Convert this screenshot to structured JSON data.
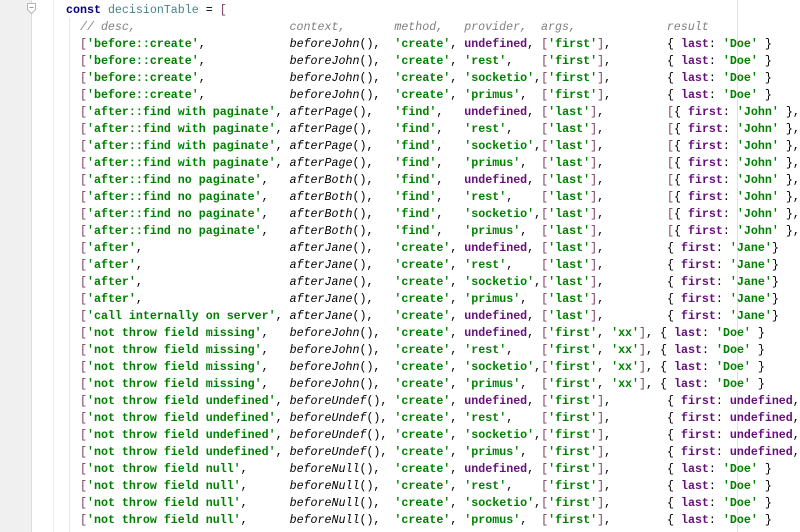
{
  "editor": {
    "lines": [
      "const decisionTable = [",
      "  // desc,                      context,       method,   provider,  args,             result",
      "  ['before::create',            beforeJohn(),  'create', undefined, ['first'],        { last: 'Doe' }",
      "  ['before::create',            beforeJohn(),  'create', 'rest',    ['first'],        { last: 'Doe' }",
      "  ['before::create',            beforeJohn(),  'create', 'socketio',['first'],        { last: 'Doe' }",
      "  ['before::create',            beforeJohn(),  'create', 'primus',  ['first'],        { last: 'Doe' }",
      "  ['after::find with paginate', afterPage(),   'find',   undefined, ['last'],         [{ first: 'John' },",
      "  ['after::find with paginate', afterPage(),   'find',   'rest',    ['last'],         [{ first: 'John' },",
      "  ['after::find with paginate', afterPage(),   'find',   'socketio',['last'],         [{ first: 'John' },",
      "  ['after::find with paginate', afterPage(),   'find',   'primus',  ['last'],         [{ first: 'John' },",
      "  ['after::find no paginate',   afterBoth(),   'find',   undefined, ['last'],         [{ first: 'John' },",
      "  ['after::find no paginate',   afterBoth(),   'find',   'rest',    ['last'],         [{ first: 'John' },",
      "  ['after::find no paginate',   afterBoth(),   'find',   'socketio',['last'],         [{ first: 'John' },",
      "  ['after::find no paginate',   afterBoth(),   'find',   'primus',  ['last'],         [{ first: 'John' },",
      "  ['after',                     afterJane(),   'create', undefined, ['last'],         { first: 'Jane'}",
      "  ['after',                     afterJane(),   'create', 'rest',    ['last'],         { first: 'Jane'}",
      "  ['after',                     afterJane(),   'create', 'socketio',['last'],         { first: 'Jane'}",
      "  ['after',                     afterJane(),   'create', 'primus',  ['last'],         { first: 'Jane'}",
      "  ['call internally on server', afterJane(),   'create', undefined, ['last'],         { first: 'Jane'}",
      "  ['not throw field missing',   beforeJohn(),  'create', undefined, ['first', 'xx'], { last: 'Doe' }",
      "  ['not throw field missing',   beforeJohn(),  'create', 'rest',    ['first', 'xx'], { last: 'Doe' }",
      "  ['not throw field missing',   beforeJohn(),  'create', 'socketio',['first', 'xx'], { last: 'Doe' }",
      "  ['not throw field missing',   beforeJohn(),  'create', 'primus',  ['first', 'xx'], { last: 'Doe' }",
      "  ['not throw field undefined', beforeUndef(), 'create', undefined, ['first'],        { first: undefined,",
      "  ['not throw field undefined', beforeUndef(), 'create', 'rest',    ['first'],        { first: undefined,",
      "  ['not throw field undefined', beforeUndef(), 'create', 'socketio',['first'],        { first: undefined,",
      "  ['not throw field undefined', beforeUndef(), 'create', 'primus',  ['first'],        { first: undefined,",
      "  ['not throw field null',      beforeNull(),  'create', undefined, ['first'],        { last: 'Doe' }",
      "  ['not throw field null',      beforeNull(),  'create', 'rest',    ['first'],        { last: 'Doe' }",
      "  ['not throw field null',      beforeNull(),  'create', 'socketio',['first'],        { last: 'Doe' }",
      "  ['not throw field null',      beforeNull(),  'create', 'promus',  ['first'],        { last: 'Doe' }"
    ],
    "colors": {
      "string": "#008000",
      "keyword": "#000080",
      "comment": "#808080",
      "property": "#660e7a",
      "gutter": "#f0f0f0"
    },
    "icons": {
      "fold": "fold-collapse-icon"
    }
  }
}
